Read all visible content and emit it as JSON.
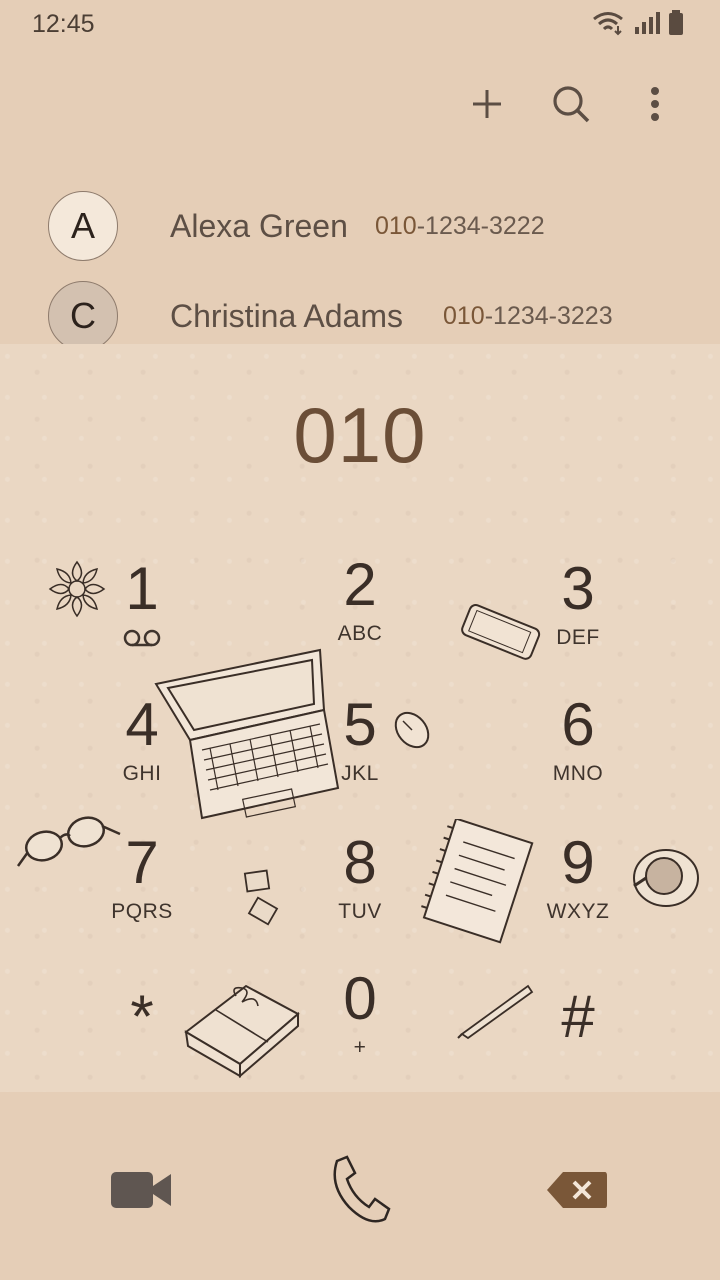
{
  "status_bar": {
    "time": "12:45"
  },
  "toolbar": {
    "icons": [
      "add-icon",
      "search-icon",
      "more-options-icon"
    ]
  },
  "suggestions": [
    {
      "initial": "A",
      "name": "Alexa Green",
      "number_match": "010",
      "number_rest": "-1234-3222",
      "avatar_color": "#f4e8da"
    },
    {
      "initial": "C",
      "name": "Christina Adams",
      "number_match": "010",
      "number_rest": "-1234-3223",
      "avatar_color": "#d3c1b0"
    }
  ],
  "dialpad": {
    "entered": "010",
    "keys": [
      {
        "digit": "1",
        "letters": ""
      },
      {
        "digit": "2",
        "letters": "ABC"
      },
      {
        "digit": "3",
        "letters": "DEF"
      },
      {
        "digit": "4",
        "letters": "GHI"
      },
      {
        "digit": "5",
        "letters": "JKL"
      },
      {
        "digit": "6",
        "letters": "MNO"
      },
      {
        "digit": "7",
        "letters": "PQRS"
      },
      {
        "digit": "8",
        "letters": "TUV"
      },
      {
        "digit": "9",
        "letters": "WXYZ"
      },
      {
        "digit": "*",
        "letters": ""
      },
      {
        "digit": "0",
        "letters": "+"
      },
      {
        "digit": "#",
        "letters": ""
      }
    ]
  },
  "bottom_actions": {
    "icons": [
      "video-call-icon",
      "phone-icon",
      "backspace-icon"
    ]
  },
  "colors": {
    "accent": "#7a5738",
    "background": "#e5ceb7",
    "dialpad_bg": "#ead7c3"
  }
}
